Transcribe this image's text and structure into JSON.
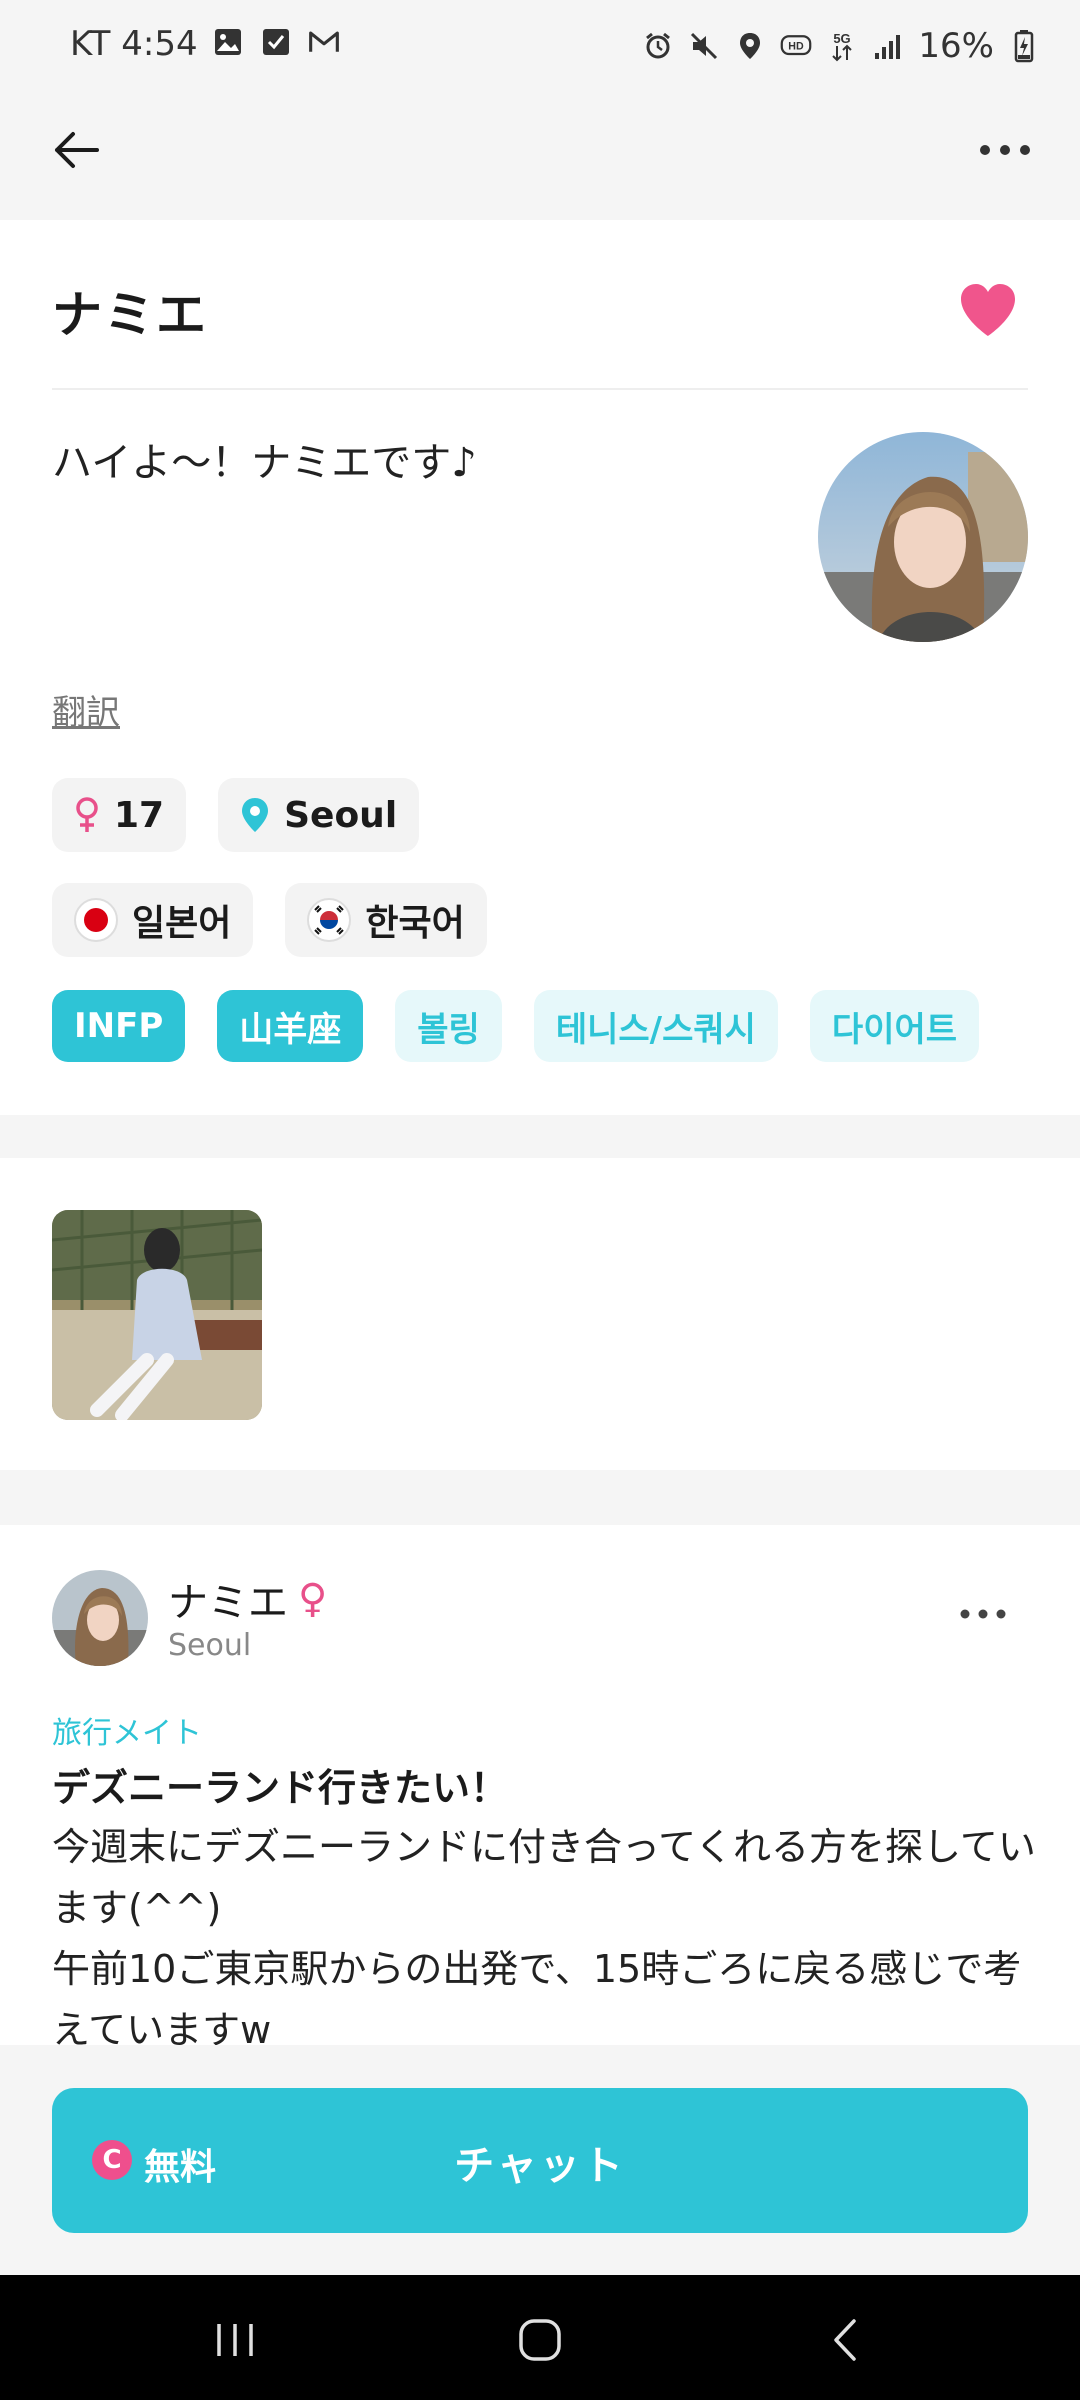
{
  "status_bar": {
    "carrier_time": "KT 4:54",
    "battery": "16%"
  },
  "profile": {
    "name": "ナミエ",
    "bio": "ハイよ～！ナミエです♪",
    "translate_label": "翻訳",
    "age": "17",
    "location": "Seoul",
    "languages": [
      "일본어",
      "한국어"
    ],
    "tags_filled": [
      "INFP",
      "山羊座"
    ],
    "tags_light": [
      "볼링",
      "테니스/스쿼시",
      "다이어트"
    ]
  },
  "post": {
    "author": "ナミエ",
    "gender_symbol": "♀",
    "location": "Seoul",
    "category": "旅行メイト",
    "title": "デズニーランド行きたい！",
    "body": "今週末にデズニーランドに付き合ってくれる方を探しています(^^)\n午前10ご東京駅からの出発で、15時ごろに戻る感じで考えていますw"
  },
  "chat": {
    "coin_symbol": "C",
    "free_label": "無料",
    "chat_label": "チャット"
  },
  "colors": {
    "accent": "#2ec4d6",
    "accent_light": "#e6f8fa",
    "heart": "#f0558c",
    "female": "#e8508a"
  }
}
